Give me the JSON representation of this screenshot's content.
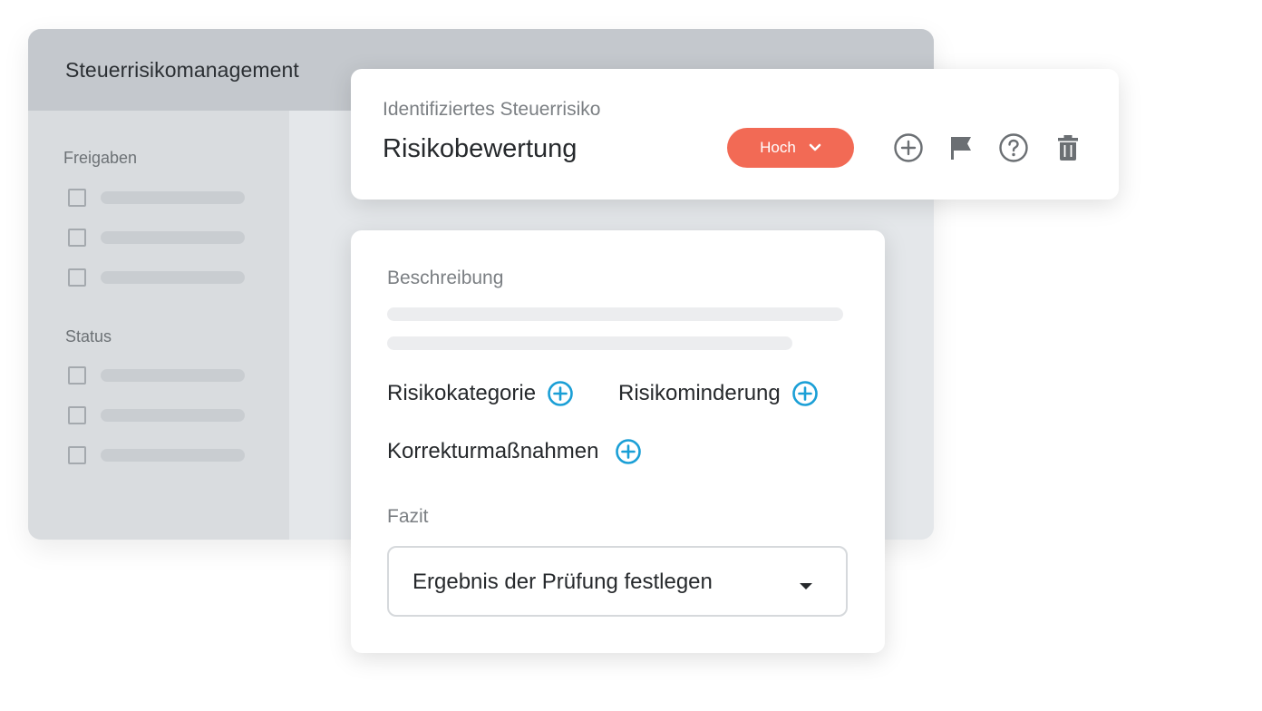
{
  "app": {
    "title": "Steuerrisikomanagement",
    "sidebar": {
      "sections": [
        {
          "title": "Freigaben",
          "items": 3
        },
        {
          "title": "Status",
          "items": 3
        }
      ]
    }
  },
  "risk_card": {
    "subtitle": "Identifiziertes Steuerrisiko",
    "title": "Risikobewertung",
    "severity": {
      "value": "Hoch",
      "color": "#f26a55",
      "icon": "chevron-down-icon"
    },
    "actions": [
      {
        "name": "add-icon"
      },
      {
        "name": "flag-icon"
      },
      {
        "name": "help-icon"
      },
      {
        "name": "trash-icon"
      }
    ]
  },
  "detail_card": {
    "description_label": "Beschreibung",
    "links": [
      {
        "label": "Risikokategorie",
        "icon": "plus-circle-icon"
      },
      {
        "label": "Risikominderung",
        "icon": "plus-circle-icon"
      },
      {
        "label": "Korrekturmaßnahmen",
        "icon": "plus-circle-icon"
      }
    ],
    "conclusion_label": "Fazit",
    "conclusion_select": {
      "value": "Ergebnis der Prüfung festlegen",
      "icon": "caret-down-icon"
    },
    "accent_color": "#1a9fd6"
  }
}
